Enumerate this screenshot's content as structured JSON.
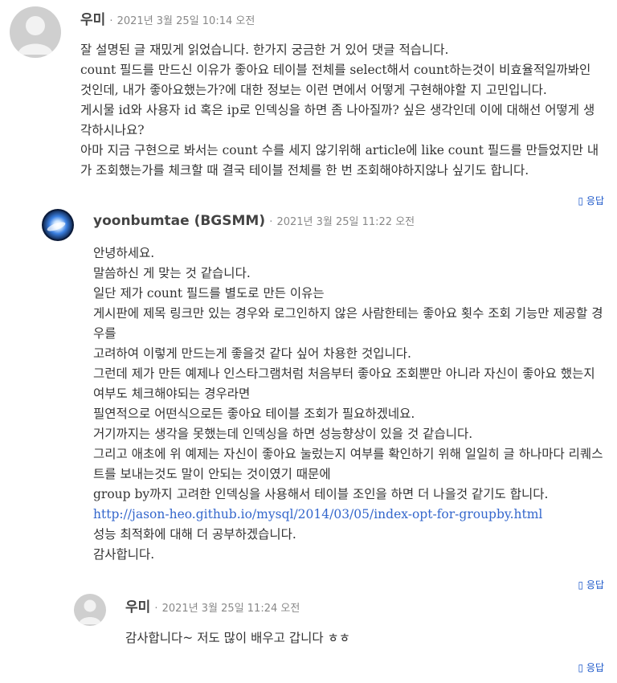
{
  "comments": [
    {
      "author": "우미",
      "separator": "·",
      "date": "2021년 3월 25일 10:14 오전",
      "paragraphs": [
        "잘 설명된 글 재밌게 읽었습니다. 한가지 궁금한 거 있어 댓글 적습니다.",
        "count 필드를 만드신 이유가 좋아요 테이블 전체를 select해서 count하는것이 비효율적일까봐인 것인데, 내가 좋아요했는가?에 대한 정보는 이런 면에서 어떻게 구현해야할 지 고민입니다.",
        "게시물 id와 사용자 id 혹은 ip로 인덱싱을 하면 좀 나아질까? 싶은 생각인데 이에 대해선 어떻게 생각하시나요?",
        "아마 지금 구현으로 봐서는 count 수를 세지 않기위해 article에 like count 필드를 만들었지만 내가 조회했는가를 체크할 때 결국 테이블 전체를 한 번 조회해야하지않나 싶기도 합니다."
      ],
      "reply_label": "응답",
      "reply_icon": "reply-icon"
    },
    {
      "author": "yoonbumtae (BGSMM)",
      "separator": "·",
      "date": "2021년 3월 25일 11:22 오전",
      "paragraphs": [
        "안녕하세요.",
        "말씀하신 게 맞는 것 같습니다.",
        "일단 제가 count 필드를 별도로 만든 이유는",
        "게시판에 제목 링크만 있는 경우와 로그인하지 않은 사람한테는 좋아요 횟수 조회 기능만 제공할 경우를",
        "고려하여 이렇게 만드는게 좋을것 같다 싶어 차용한 것입니다.",
        "그런데 제가 만든 예제나 인스타그램처럼 처음부터 좋아요 조회뿐만 아니라 자신이 좋아요 했는지 여부도 체크해야되는 경우라면",
        "필연적으로 어떤식으로든 좋아요 테이블 조회가 필요하겠네요.",
        "거기까지는 생각을 못했는데 인덱싱을 하면 성능향상이 있을 것 같습니다.",
        "그리고 애초에 위 예제는 자신이 좋아요 눌렀는지 여부를 확인하기 위해 일일히 글 하나마다 리퀘스트를 보내는것도 말이 안되는 것이였기 때문에",
        "group by까지 고려한 인덱싱을 사용해서 테이블 조인을 하면 더 나을것 같기도 합니다."
      ],
      "link": "http://jason-heo.github.io/mysql/2014/03/05/index-opt-for-groupby.html",
      "closing": [
        "성능 최적화에 대해 더 공부하겠습니다.",
        "감사합니다."
      ],
      "reply_label": "응답",
      "reply_icon": "reply-icon"
    },
    {
      "author": "우미",
      "separator": "·",
      "date": "2021년 3월 25일 11:24 오전",
      "paragraphs": [
        "감사합니다~ 저도 많이 배우고 갑니다 ㅎㅎ"
      ],
      "reply_label": "응답",
      "reply_icon": "reply-icon"
    }
  ]
}
